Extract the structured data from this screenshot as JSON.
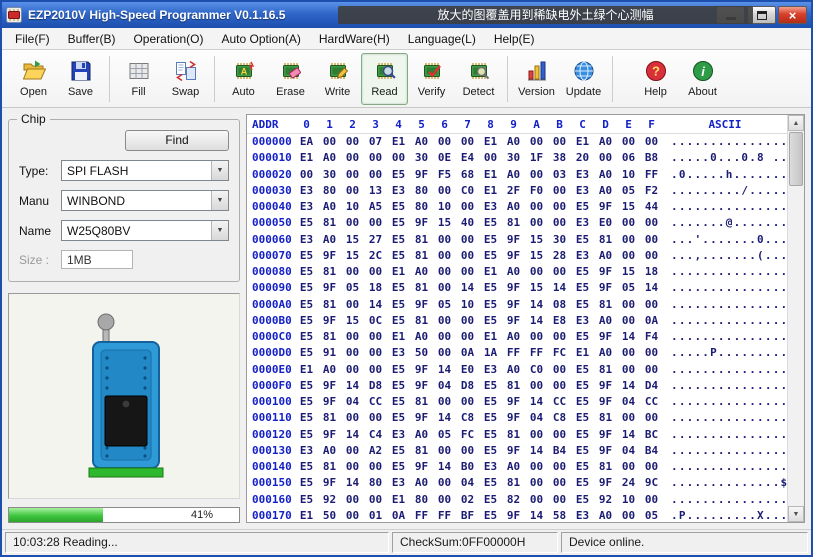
{
  "window": {
    "title": "EZP2010V High-Speed Programmer  V0.1.16.5",
    "overlay_text": "放大的图覆盖用到稀缺电外土绿个心测幅",
    "close_glyph": "×"
  },
  "menu": {
    "items": [
      {
        "label": "File(F)"
      },
      {
        "label": "Buffer(B)"
      },
      {
        "label": "Operation(O)"
      },
      {
        "label": "Auto Option(A)"
      },
      {
        "label": "HardWare(H)"
      },
      {
        "label": "Language(L)"
      },
      {
        "label": "Help(E)"
      }
    ]
  },
  "toolbar": {
    "buttons": [
      {
        "label": "Open"
      },
      {
        "label": "Save"
      },
      {
        "label": "Fill"
      },
      {
        "label": "Swap"
      },
      {
        "label": "Auto"
      },
      {
        "label": "Erase"
      },
      {
        "label": "Write"
      },
      {
        "label": "Read",
        "selected": true
      },
      {
        "label": "Verify"
      },
      {
        "label": "Detect"
      },
      {
        "label": "Version"
      },
      {
        "label": "Update"
      },
      {
        "label": "Help"
      },
      {
        "label": "About"
      }
    ]
  },
  "chip_panel": {
    "group_label": "Chip",
    "find_button": "Find",
    "type_label": "Type:",
    "type_value": "SPI FLASH",
    "manu_label": "Manu",
    "manu_value": "WINBOND",
    "name_label": "Name",
    "name_value": "W25Q80BV",
    "size_label": "Size :",
    "size_value": "1MB",
    "progress_percent": 41,
    "progress_label": "41%",
    "combo_arrow": "▼"
  },
  "hex_view": {
    "headers": {
      "addr": "ADDR",
      "cols": [
        "0",
        "1",
        "2",
        "3",
        "4",
        "5",
        "6",
        "7",
        "8",
        "9",
        "A",
        "B",
        "C",
        "D",
        "E",
        "F"
      ],
      "ascii": "ASCII"
    },
    "scroll_up": "▲",
    "scroll_down": "▼",
    "rows": [
      {
        "addr": "000000",
        "bytes": "EA 00 00 07 E1 A0 00 00 E1 A0 00 00 E1 A0 00 00",
        "ascii": "................"
      },
      {
        "addr": "000010",
        "bytes": "E1 A0 00 00 00 30 0E E4 00 30 1F 38 20 00 06 B8",
        "ascii": ".....0...0.8 ..."
      },
      {
        "addr": "000020",
        "bytes": "00 30 00 00 E5 9F F5 68 E1 A0 00 03 E3 A0 10 FF",
        "ascii": ".0.....h........"
      },
      {
        "addr": "000030",
        "bytes": "E3 80 00 13 E3 80 00 C0 E1 2F F0 00 E3 A0 05 F2",
        "ascii": "........./......"
      },
      {
        "addr": "000040",
        "bytes": "E3 A0 10 A5 E5 80 10 00 E3 A0 00 00 E5 9F 15 44",
        "ascii": "...............D"
      },
      {
        "addr": "000050",
        "bytes": "E5 81 00 00 E5 9F 15 40 E5 81 00 00 E3 E0 00 00",
        "ascii": ".......@........"
      },
      {
        "addr": "000060",
        "bytes": "E3 A0 15 27 E5 81 00 00 E5 9F 15 30 E5 81 00 00",
        "ascii": "...'.......0...."
      },
      {
        "addr": "000070",
        "bytes": "E5 9F 15 2C E5 81 00 00 E5 9F 15 28 E3 A0 00 00",
        "ascii": "...,.......(...."
      },
      {
        "addr": "000080",
        "bytes": "E5 81 00 00 E1 A0 00 00 E1 A0 00 00 E5 9F 15 18",
        "ascii": "................"
      },
      {
        "addr": "000090",
        "bytes": "E5 9F 05 18 E5 81 00 14 E5 9F 15 14 E5 9F 05 14",
        "ascii": "................"
      },
      {
        "addr": "0000A0",
        "bytes": "E5 81 00 14 E5 9F 05 10 E5 9F 14 08 E5 81 00 00",
        "ascii": "................"
      },
      {
        "addr": "0000B0",
        "bytes": "E5 9F 15 0C E5 81 00 00 E5 9F 14 E8 E3 A0 00 0A",
        "ascii": "................"
      },
      {
        "addr": "0000C0",
        "bytes": "E5 81 00 00 E1 A0 00 00 E1 A0 00 00 E5 9F 14 F4",
        "ascii": "................"
      },
      {
        "addr": "0000D0",
        "bytes": "E5 91 00 00 E3 50 00 0A 1A FF FF FC E1 A0 00 00",
        "ascii": ".....P.........."
      },
      {
        "addr": "0000E0",
        "bytes": "E1 A0 00 00 E5 9F 14 E0 E3 A0 C0 00 E5 81 00 00",
        "ascii": "................"
      },
      {
        "addr": "0000F0",
        "bytes": "E5 9F 14 D8 E5 9F 04 D8 E5 81 00 00 E5 9F 14 D4",
        "ascii": "................"
      },
      {
        "addr": "000100",
        "bytes": "E5 9F 04 CC E5 81 00 00 E5 9F 14 CC E5 9F 04 CC",
        "ascii": "................"
      },
      {
        "addr": "000110",
        "bytes": "E5 81 00 00 E5 9F 14 C8 E5 9F 04 C8 E5 81 00 00",
        "ascii": "................"
      },
      {
        "addr": "000120",
        "bytes": "E5 9F 14 C4 E3 A0 05 FC E5 81 00 00 E5 9F 14 BC",
        "ascii": "................"
      },
      {
        "addr": "000130",
        "bytes": "E3 A0 00 A2 E5 81 00 00 E5 9F 14 B4 E5 9F 04 B4",
        "ascii": "................"
      },
      {
        "addr": "000140",
        "bytes": "E5 81 00 00 E5 9F 14 B0 E3 A0 00 00 E5 81 00 00",
        "ascii": "................"
      },
      {
        "addr": "000150",
        "bytes": "E5 9F 14 80 E3 A0 00 04 E5 81 00 00 E5 9F 24 9C",
        "ascii": "..............$."
      },
      {
        "addr": "000160",
        "bytes": "E5 92 00 00 E1 80 00 02 E5 82 00 00 E5 92 10 00",
        "ascii": "................"
      },
      {
        "addr": "000170",
        "bytes": "E1 50 00 01 0A FF FF BF E5 9F 14 58 E3 A0 00 05",
        "ascii": ".P.........X...."
      }
    ]
  },
  "status_bar": {
    "reading": "10:03:28 Reading...",
    "checksum": "CheckSum:0FF00000H",
    "device": "Device online."
  }
}
